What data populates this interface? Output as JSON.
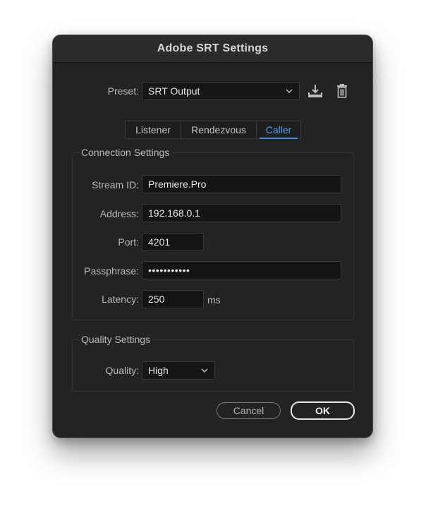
{
  "window": {
    "title": "Adobe SRT Settings"
  },
  "preset": {
    "label": "Preset:",
    "value": "SRT Output",
    "save_icon": "download-icon",
    "delete_icon": "trash-icon"
  },
  "tabs": [
    {
      "label": "Listener",
      "active": false
    },
    {
      "label": "Rendezvous",
      "active": false
    },
    {
      "label": "Caller",
      "active": true
    }
  ],
  "connection": {
    "group_title": "Connection Settings",
    "stream_id": {
      "label": "Stream ID:",
      "value": "Premiere.Pro"
    },
    "address": {
      "label": "Address:",
      "value": "192.168.0.1"
    },
    "port": {
      "label": "Port:",
      "value": "4201"
    },
    "passphrase": {
      "label": "Passphrase:",
      "value": "•••••••••••"
    },
    "latency": {
      "label": "Latency:",
      "value": "250",
      "unit": "ms"
    }
  },
  "quality": {
    "group_title": "Quality Settings",
    "label": "Quality:",
    "value": "High"
  },
  "buttons": {
    "cancel": "Cancel",
    "ok": "OK"
  },
  "colors": {
    "background": "#232323",
    "accent": "#3d8ee6",
    "text": "#b9b9b9"
  }
}
